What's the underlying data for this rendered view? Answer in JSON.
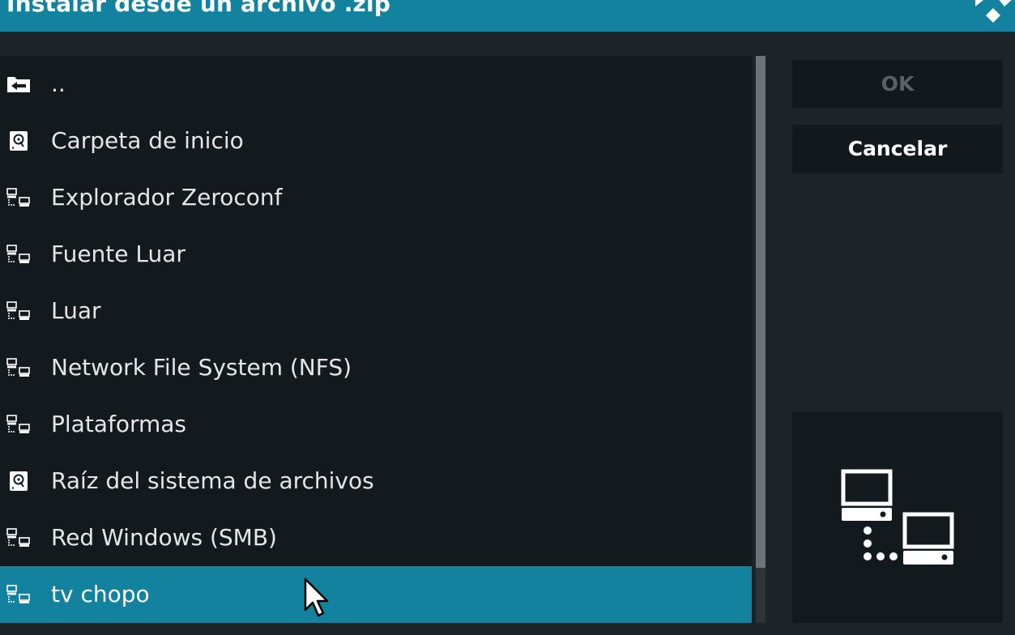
{
  "window": {
    "title": "Instalar desde un archivo .zip"
  },
  "file_list": {
    "items": [
      {
        "label": "..",
        "icon": "folder-back-icon"
      },
      {
        "label": "Carpeta de inicio",
        "icon": "hard-drive-icon"
      },
      {
        "label": "Explorador Zeroconf",
        "icon": "network-icon"
      },
      {
        "label": "Fuente Luar",
        "icon": "network-icon"
      },
      {
        "label": "Luar",
        "icon": "network-icon"
      },
      {
        "label": "Network File System (NFS)",
        "icon": "network-icon"
      },
      {
        "label": "Plataformas",
        "icon": "network-icon"
      },
      {
        "label": "Raíz del sistema de archivos",
        "icon": "hard-drive-icon"
      },
      {
        "label": "Red Windows (SMB)",
        "icon": "network-icon"
      },
      {
        "label": "tv chopo",
        "icon": "network-icon"
      }
    ],
    "focused_index": 9
  },
  "buttons": {
    "ok_label": "OK",
    "ok_enabled": false,
    "cancel_label": "Cancelar"
  },
  "preview": {
    "icon": "network-computers-icon"
  },
  "colors": {
    "accent": "#12829f",
    "background": "#1d2428",
    "list_background": "#121a1d",
    "disabled_text": "#5a6165"
  }
}
